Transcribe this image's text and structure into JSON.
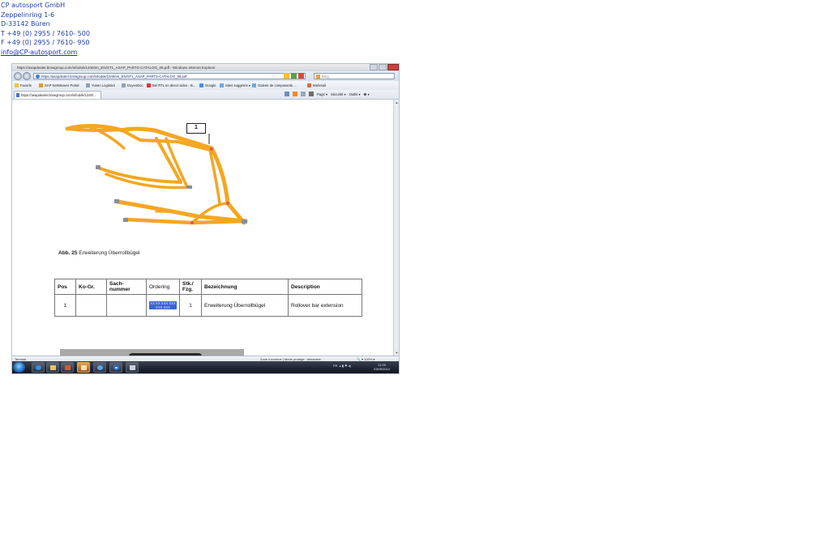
{
  "company": {
    "name": "CP autosport GmbH",
    "street": "Zeppelinring 1-6",
    "city": "D-33142 Büren",
    "phone": "T +49 (0) 2955 / 7610- 500",
    "fax": "F +49 (0) 2955 / 7610- 950",
    "email": "info@CP-autosport.com"
  },
  "browser": {
    "title": "https://asapdealer.bmwgroup.com/infodok/1340/en_EN/ST1_ASAP_PARTS-CATALOG_08.pdf - Windows Internet Explorer",
    "url": "https://asapdealer.bmwgroup.com/infodok/1340/en_EN/ST1_ASAP_PARTS-CATALOG_08.pdf",
    "search_placeholder": "Bing",
    "favorites": [
      {
        "label": "Favoris"
      },
      {
        "label": "SAP NetWeaver Portal"
      },
      {
        "label": "Yusen Logistics"
      },
      {
        "label": "DoyenDoc"
      },
      {
        "label": "Bel RTL en direct video - B..."
      },
      {
        "label": "Google"
      },
      {
        "label": "Sites suggérés ▾"
      },
      {
        "label": "Galerie de composants ..."
      },
      {
        "label": "Webmail"
      }
    ],
    "tab_label": "https://asapdealer.bmwgroup.com/infodok/1340/...",
    "commands": {
      "page": "Page ▾",
      "security": "Sécurité ▾",
      "tools": "Outils ▾",
      "help": "❷ ▾"
    },
    "status_left": "Terminé",
    "status_zone": "Zone Inconnue | Mode protégé : désactivé",
    "status_zoom": "🔍 ▾  100% ▾"
  },
  "document": {
    "callout_number": "1",
    "caption_bold": "Abb. 25",
    "caption_text": " Erweiterung Überrollbügel",
    "table": {
      "headers": [
        "Pos",
        "Ko-Gr.",
        "Sach-\nnummer",
        "Ordering",
        "Stk./\nFzg.",
        "Bezeichnung",
        "Description"
      ],
      "rows": [
        {
          "pos": "1",
          "ko_gr": "",
          "sachnummer": "",
          "ordering_line1": "XX XX XXX XXX",
          "ordering_line2": "XXX XXX",
          "stk": "1",
          "bezeichnung": "Erweiterung Überrollbügel",
          "description": "Rollover bar extension"
        }
      ]
    }
  },
  "taskbar": {
    "tray_lang": "FR",
    "clock_time": "11:29",
    "clock_date": "23/05/2014"
  },
  "colors": {
    "rollcage_orange": "#f5a623",
    "selection_blue": "#3a63d6",
    "address_text": "#1f3fa8"
  }
}
